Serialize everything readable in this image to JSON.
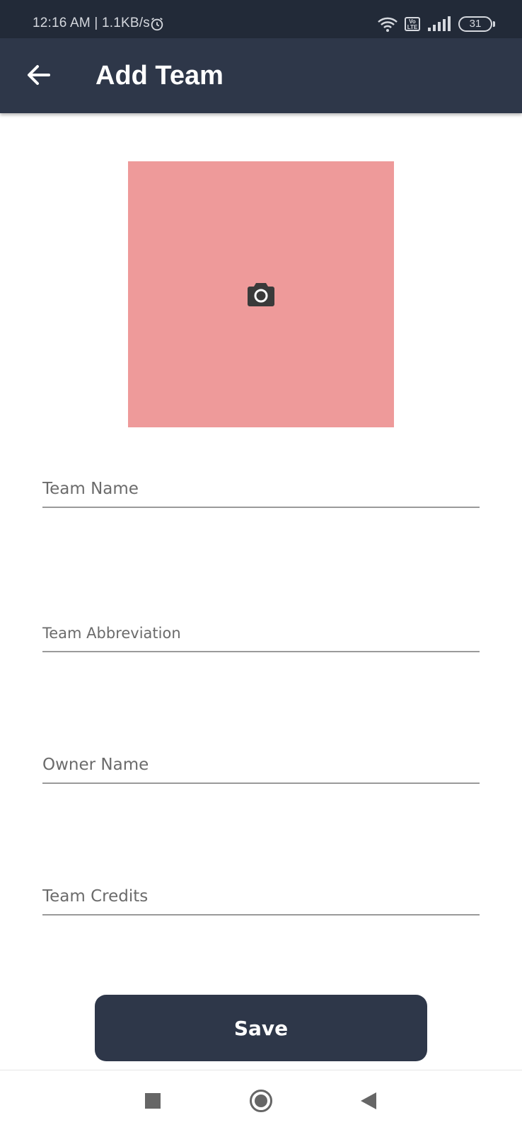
{
  "status_bar": {
    "time": "12:16 AM",
    "network_speed": "1.1KB/s",
    "volte_label": "Vo LTE",
    "battery_level": "31"
  },
  "app_bar": {
    "title": "Add Team",
    "back_icon": "arrow-left-icon"
  },
  "photo_picker": {
    "icon": "camera-icon",
    "background_color": "#ee9a9a"
  },
  "form": {
    "fields": [
      {
        "placeholder": "Team Name",
        "value": ""
      },
      {
        "placeholder": "Team Abbreviation",
        "value": ""
      },
      {
        "placeholder": "Owner Name",
        "value": ""
      },
      {
        "placeholder": "Team Credits",
        "value": ""
      }
    ],
    "save_label": "Save"
  },
  "colors": {
    "primary": "#2e3749",
    "status_bar": "#222a38"
  },
  "nav_bar": {
    "icons": [
      "recent-apps-icon",
      "home-icon",
      "back-icon"
    ]
  }
}
